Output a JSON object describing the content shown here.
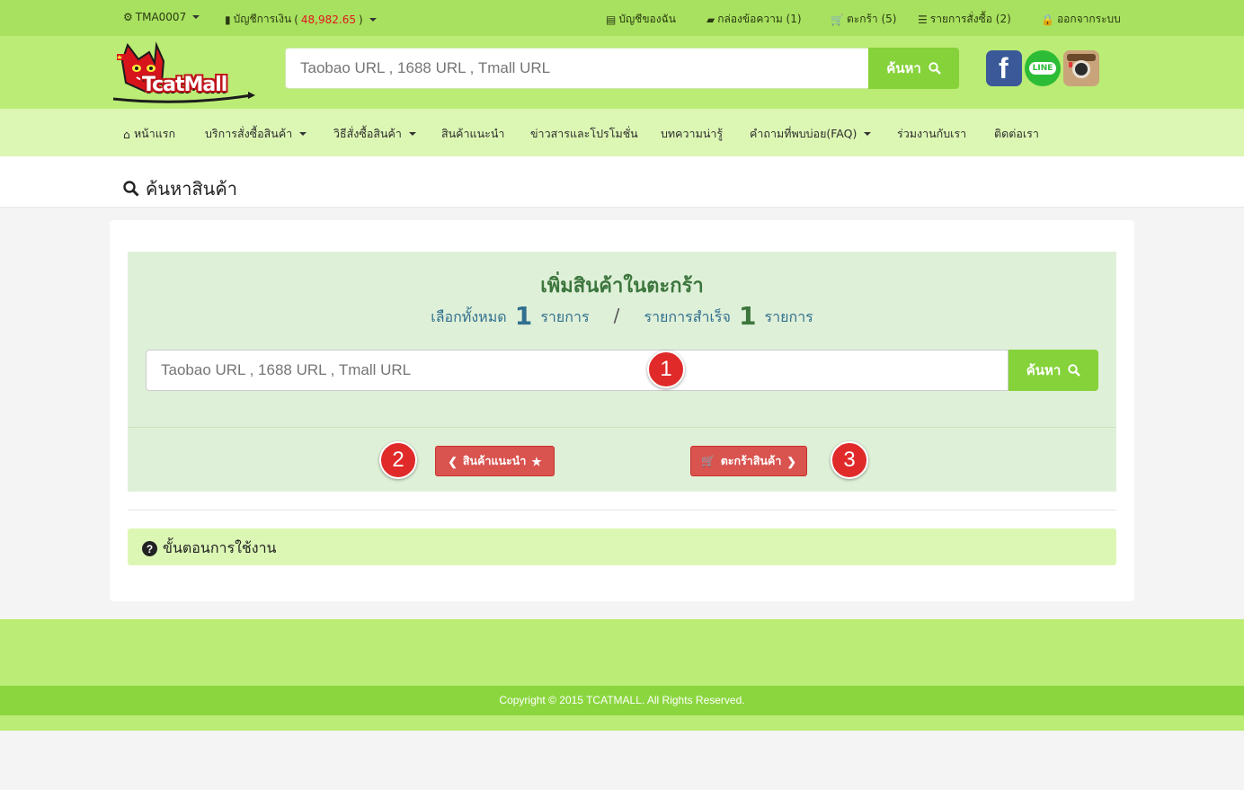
{
  "topbar": {
    "account_id": "TMA0007",
    "wallet_label": "บัญชีการเงิน",
    "wallet_open": "(",
    "wallet_amount": "48,982.65",
    "wallet_close": ")",
    "my_account": "บัญชีของฉัน",
    "inbox": "กล่องข้อความ (1)",
    "cart": "ตะกร้า (5)",
    "orders": "รายการสั่งซื้อ (2)",
    "logout": "ออกจากระบบ"
  },
  "header": {
    "logo_text": "TcatMall",
    "search_placeholder": "Taobao URL , 1688 URL , Tmall URL",
    "search_button": "ค้นหา",
    "social": {
      "facebook": "f",
      "line": "LINE"
    }
  },
  "nav": {
    "items": [
      "หน้าแรก",
      "บริการสั่งซื้อสินค้า",
      "วิธีสั่งซื้อสินค้า",
      "สินค้าแนะนำ",
      "ข่าวสารและโปรโมชั่น",
      "บทความน่ารู้",
      "คำถามที่พบบ่อย(FAQ)",
      "ร่วมงานกับเรา",
      "ติดต่อเรา"
    ]
  },
  "page": {
    "title": "ค้นหาสินค้า"
  },
  "panel": {
    "title": "เพิ่มสินค้าในตะกร้า",
    "selected_label": "เลือกทั้งหมด",
    "selected_count": "1",
    "selected_unit": "รายการ",
    "separator": "/",
    "success_label": "รายการสำเร็จ",
    "success_count": "1",
    "success_unit": "รายการ",
    "search_placeholder": "Taobao URL , 1688 URL , Tmall URL",
    "search_button": "ค้นหา",
    "recommended_button": "สินค้าแนะนำ",
    "cart_button": "ตะกร้าสินค้า",
    "badges": [
      "1",
      "2",
      "3"
    ],
    "help_label": "ขั้นตอนการใช้งาน"
  },
  "footer": {
    "copyright": "Copyright © 2015 TCATMALL. All Rights Reserved."
  },
  "colors": {
    "topbar": "#a8e15f",
    "header": "#bbec75",
    "nav": "#dcf7b4",
    "accent_green": "#86d23a",
    "danger_red": "#d9534f",
    "panel_green": "#dff0d8"
  }
}
